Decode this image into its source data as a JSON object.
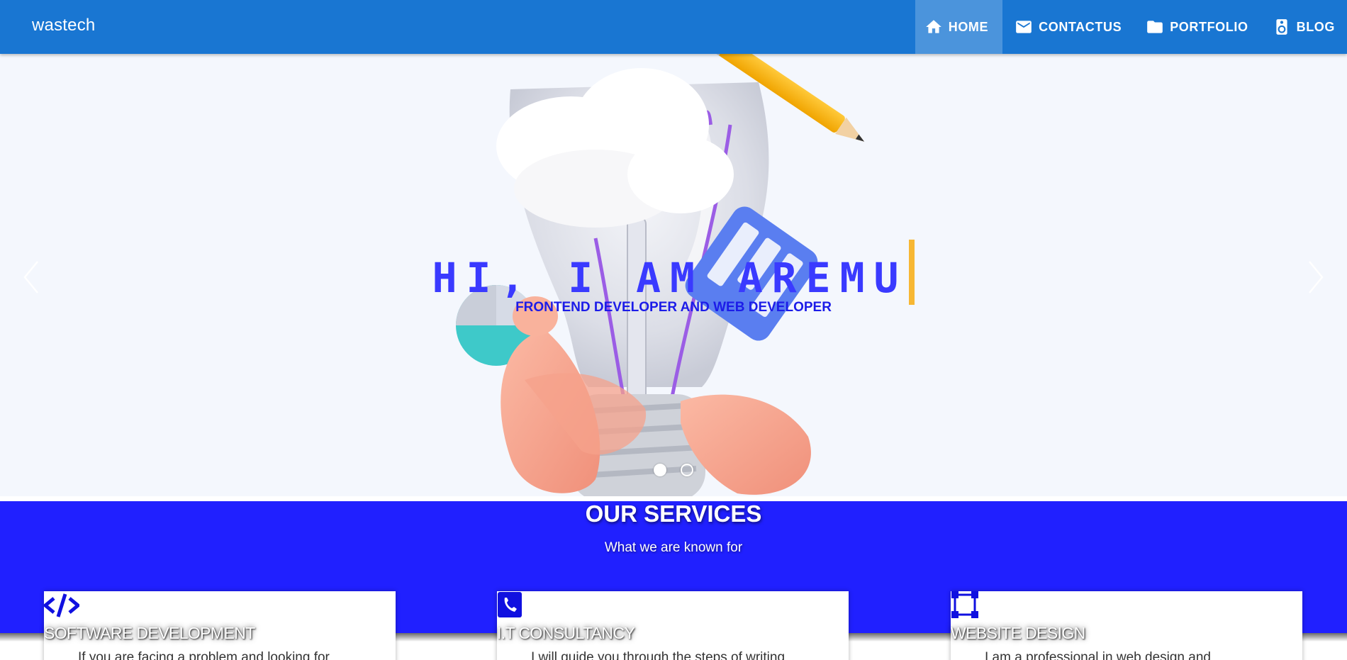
{
  "nav": {
    "brand": "wastech",
    "items": [
      {
        "label": "HOME",
        "icon": "home-icon",
        "active": true
      },
      {
        "label": "CONTACTUS",
        "icon": "mail-icon",
        "active": false
      },
      {
        "label": "PORTFOLIO",
        "icon": "folder-icon",
        "active": false
      },
      {
        "label": "BLOG",
        "icon": "speaker-icon",
        "active": false
      }
    ]
  },
  "hero": {
    "title": "HI, I AM AREMU",
    "subtitle": "FRONTEND DEVELOPER AND WEB DEVELOPER",
    "slides": 2,
    "active_slide": 1
  },
  "services": {
    "title": "OUR SERVICES",
    "subtitle": "What we are known for",
    "cards": [
      {
        "title": "SOFTWARE DEVELOPMENT",
        "text": "If you are facing a problem and looking for",
        "icon": "code-icon"
      },
      {
        "title": "I.T CONSULTANCY",
        "text": "I will guide you through the steps of writing",
        "icon": "phone-icon"
      },
      {
        "title": "WEBSITE DESIGN",
        "text": "I am a professional in web design and",
        "icon": "vector-square-icon"
      }
    ]
  },
  "colors": {
    "nav": "#1976d2",
    "services": "#2020ff",
    "hero_title": "#3a3aff",
    "cursor": "#f7b733"
  }
}
